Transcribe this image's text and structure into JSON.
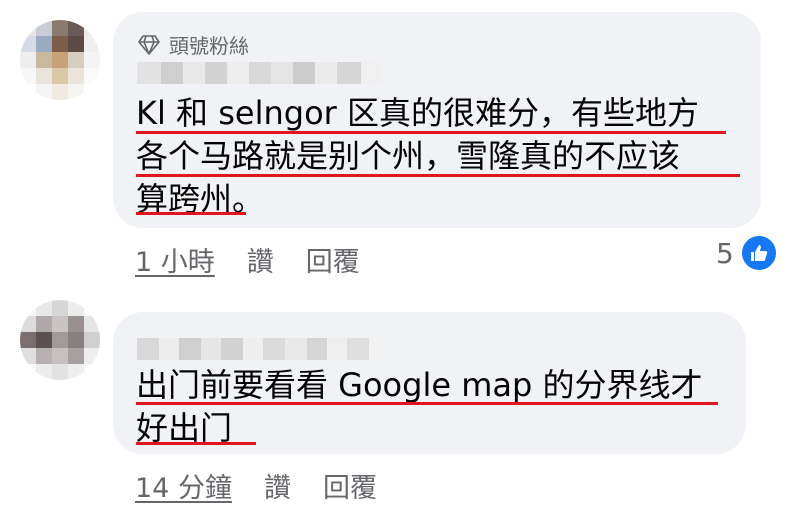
{
  "comments": [
    {
      "badge": "頭號粉絲",
      "lines": [
        "Kl 和 selngor 区真的很难分，有些地方",
        "各个马路就是别个州，雪隆真的不应该",
        "算跨州。"
      ],
      "time": "1 小時",
      "like_label": "讚",
      "reply_label": "回覆",
      "reaction_count": "5",
      "avatar_colors": [
        "#e8e6e4",
        "#c9ccd3",
        "#8a7a70",
        "#6a5a55",
        "#ecebe9",
        "#d5dce6",
        "#9aaac0",
        "#7d5c4a",
        "#5d4a45",
        "#f0efee",
        "#eeeeee",
        "#c8b8a0",
        "#c9a27a",
        "#d6cdbf",
        "#f4f4f4",
        "#f7f7f7",
        "#e8e4dc",
        "#d9c9a8",
        "#eae4da",
        "#fafafa",
        "#ffffff",
        "#f5f5f5",
        "#efe9e0",
        "#f6f4f0",
        "#ffffff"
      ],
      "accent": "#e0161e"
    },
    {
      "lines": [
        "出门前要看看 Google map 的分界线才",
        "好出门"
      ],
      "time": "14 分鐘",
      "like_label": "讚",
      "reply_label": "回覆",
      "avatar_colors": [
        "#f5f5f5",
        "#e8e8e8",
        "#d6d6d6",
        "#ececec",
        "#fafafa",
        "#dcdcdc",
        "#b0a8a8",
        "#c8c4c4",
        "#9a9090",
        "#e5e5e5",
        "#7a6e6e",
        "#5a5050",
        "#a09a9a",
        "#888080",
        "#cfcfcf",
        "#e0dede",
        "#b8b0b0",
        "#c8c0c0",
        "#a8a0a0",
        "#eeeeee",
        "#f8f8f8",
        "#ececec",
        "#e2e2e2",
        "#efefef",
        "#fafafa"
      ],
      "accent": "#e0161e"
    }
  ]
}
